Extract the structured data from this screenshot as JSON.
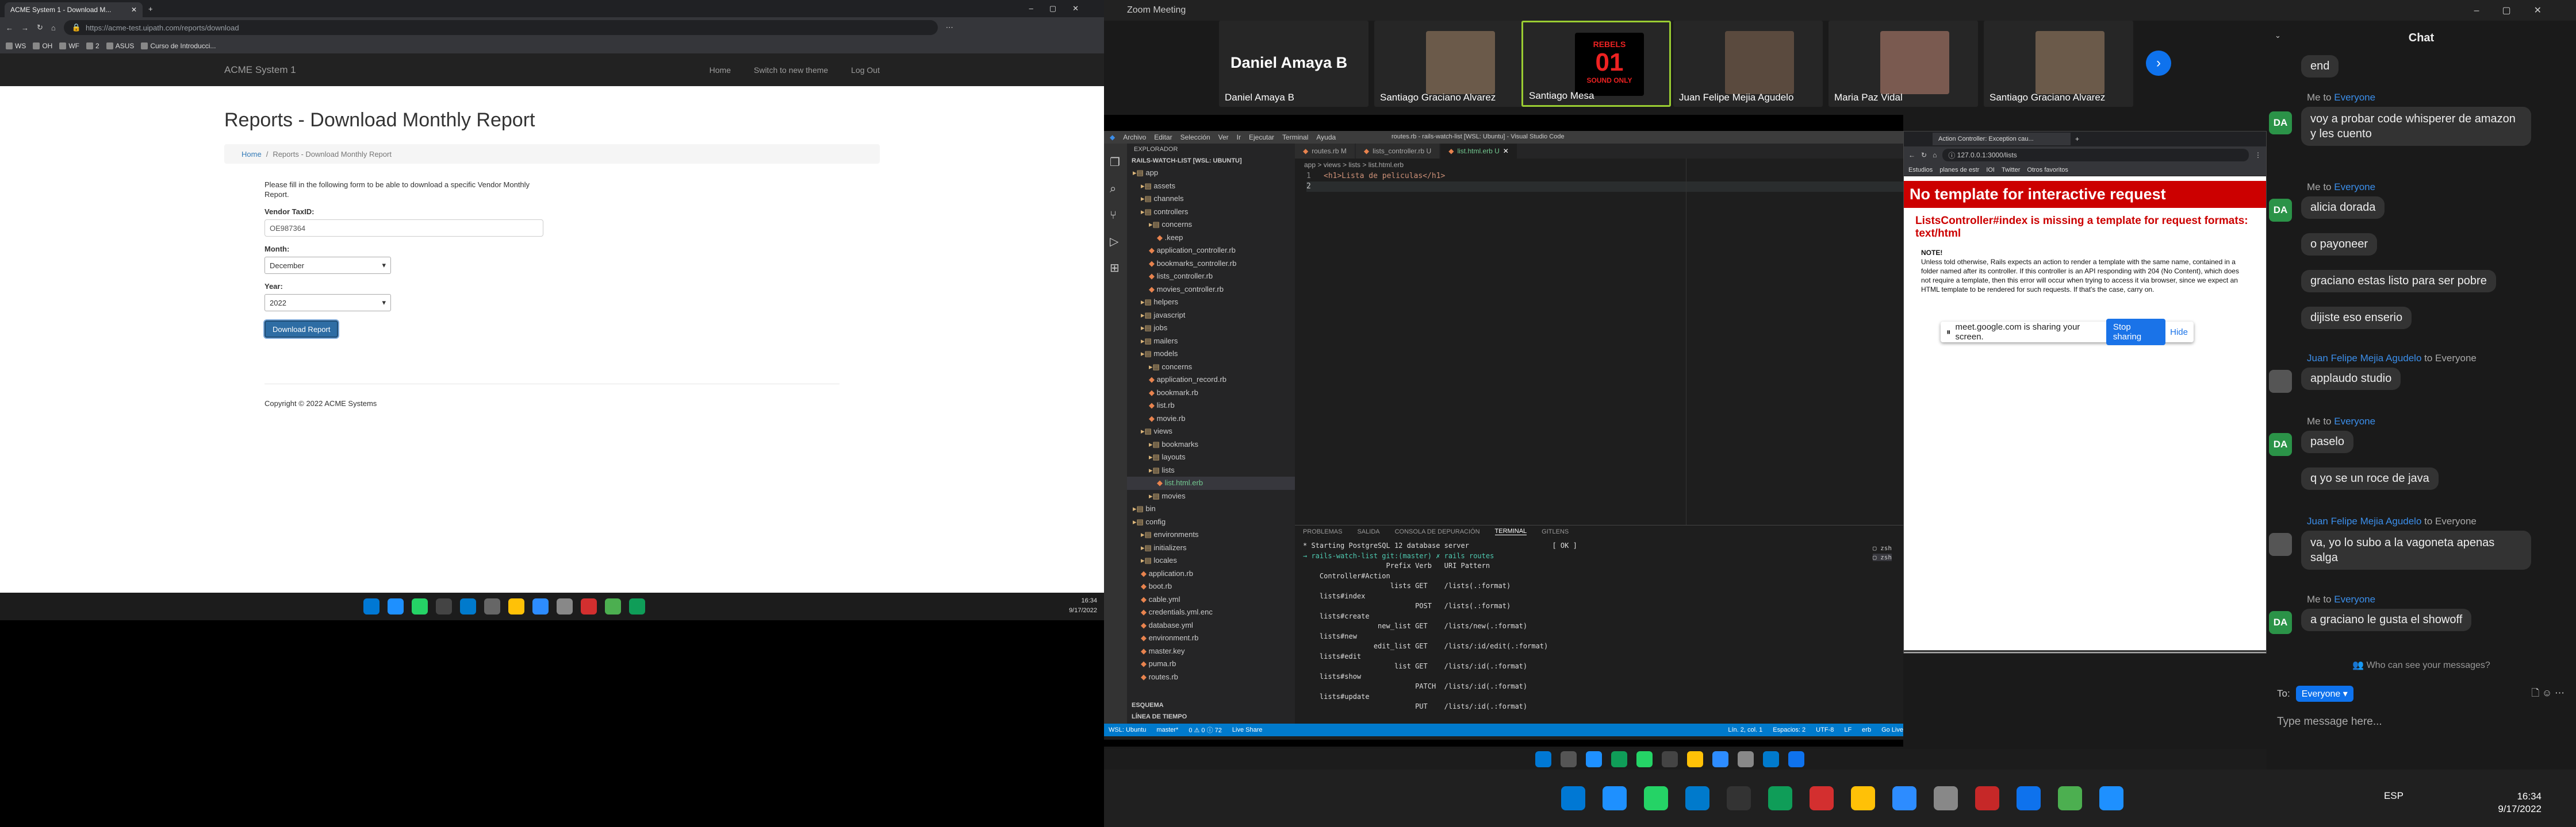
{
  "left_browser": {
    "tab_title": "ACME System 1 - Download M...",
    "url": "https://acme-test.uipath.com/reports/download",
    "bookmarks": [
      "WS",
      "OH",
      "WF",
      "2",
      "ASUS",
      "Curso de Introducci..."
    ],
    "navbar": {
      "brand": "ACME System 1",
      "links": [
        "Home",
        "Switch to new theme",
        "Log Out"
      ]
    },
    "page_title": "Reports - Download Monthly Report",
    "breadcrumb": {
      "home": "Home",
      "current": "Reports - Download Monthly Report"
    },
    "instructions": "Please fill in the following form to be able to download a specific Vendor Monthly Report.",
    "vendor_label": "Vendor TaxID:",
    "vendor_value": "OE987364",
    "month_label": "Month:",
    "month_value": "December",
    "year_label": "Year:",
    "year_value": "2022",
    "button": "Download Report",
    "footer": "Copyright © 2022 ACME Systems",
    "time": "16:34",
    "date": "9/17/2022"
  },
  "zoom": {
    "window_title": "Zoom Meeting",
    "participants": [
      "Daniel Amaya B",
      "Santiago Graciano Alvarez",
      "Santiago Mesa",
      "Juan Felipe Mejia Agudelo",
      "Maria Paz Vidal",
      "Santiago Graciano Alvarez"
    ],
    "featured_name": "Daniel Amaya B",
    "rebels_text": "REBELS",
    "rebels_sub": "SOUND ONLY",
    "share_text": "meet.google.com is sharing your screen.",
    "stop_label": "Stop sharing",
    "hide_label": "Hide",
    "chat": {
      "title": "Chat",
      "me": "Me to",
      "everyone": "Everyone",
      "msgs": [
        "end",
        "voy a probar code whisperer de amazon y les cuento",
        "alicia dorada",
        "o payoneer",
        "graciano estas listo para ser pobre",
        "dijiste eso enserio",
        "applaudo studio",
        "paselo",
        "q yo se un roce de java",
        "va, yo lo subo a la vagoneta apenas salga",
        "a graciano le gusta el showoff"
      ],
      "juan": "Juan Felipe Mejia Agudelo",
      "to_everyone": "to Everyone",
      "who_can_see": "Who can see your messages?",
      "to_label": "To:",
      "to_value": "Everyone",
      "placeholder": "Type message here...",
      "av": "DA"
    },
    "time": "16:34",
    "date": "9/17/2022",
    "lang": "ESP"
  },
  "vscode": {
    "title": "routes.rb - rails-watch-list [WSL: Ubuntu] - Visual Studio Code",
    "menus": [
      "Archivo",
      "Editar",
      "Selección",
      "Ver",
      "Ir",
      "Ejecutar",
      "Terminal",
      "Ayuda"
    ],
    "explorer": "EXPLORADOR",
    "project": "RAILS-WATCH-LIST [WSL: UBUNTU]",
    "tabs": [
      "routes.rb M",
      "lists_controller.rb U",
      "list.html.erb U"
    ],
    "tree": [
      "app",
      "assets",
      "channels",
      "controllers",
      "concerns",
      ".keep",
      "application_controller.rb",
      "bookmarks_controller.rb",
      "lists_controller.rb",
      "movies_controller.rb",
      "helpers",
      "javascript",
      "jobs",
      "mailers",
      "models",
      "concerns",
      "application_record.rb",
      "bookmark.rb",
      "list.rb",
      "movie.rb",
      "views",
      "bookmarks",
      "layouts",
      "lists",
      "list.html.erb",
      "movies",
      "bin",
      "config",
      "environments",
      "initializers",
      "locales",
      "application.rb",
      "boot.rb",
      "cable.yml",
      "credentials.yml.enc",
      "database.yml",
      "environment.rb",
      "master.key",
      "puma.rb",
      "routes.rb"
    ],
    "outline": "ESQUEMA",
    "timeline": "LÍNEA DE TIEMPO",
    "breadcrumb": "app > views > lists > list.html.erb",
    "code1": "<h1>Lista de peliculas</h1>",
    "panel_tabs": [
      "PROBLEMAS",
      "SALIDA",
      "CONSOLA DE DEPURACIÓN",
      "TERMINAL",
      "GITLENS"
    ],
    "term": [
      "* Starting PostgreSQL 12 database server                    [ OK ]",
      "→ rails-watch-list git:(master) ✗ rails routes",
      "                    Prefix Verb   URI Pattern",
      "    Controller#Action",
      "                     lists GET    /lists(.:format)",
      "    lists#index",
      "                           POST   /lists(.:format)",
      "    lists#create",
      "                  new_list GET    /lists/new(.:format)",
      "    lists#new",
      "                 edit_list GET    /lists/:id/edit(.:format)",
      "    lists#edit",
      "                      list GET    /lists/:id(.:format)",
      "    lists#show",
      "                           PATCH  /lists/:id(.:format)",
      "    lists#update",
      "                           PUT    /lists/:id(.:format)"
    ],
    "status": [
      "WSL: Ubuntu",
      "master*",
      "0 ⚠ 0 ⓘ 72",
      "Live Share",
      "Lín. 2, col. 1",
      "Espacios: 2",
      "UTF-8",
      "LF",
      "erb",
      "Go Live"
    ]
  },
  "small_browser": {
    "tab": "Action Controller: Exception cau...",
    "url": "127.0.0.1:3000/lists",
    "bookmarks": [
      "Estudios",
      "planes de estr",
      "IOI",
      "Twitter",
      "Otros favoritos"
    ],
    "error_title": "No template for interactive request",
    "error_sub": "ListsController#index is missing a template for request formats: text/html",
    "note_title": "NOTE!",
    "note": "Unless told otherwise, Rails expects an action to render a template with the same name, contained in a folder named after its controller. If this controller is an API responding with 204 (No Content), which does not require a template, then this error will occur when trying to access it via browser, since we expect an HTML template to be rendered for such requests. If that's the case, carry on."
  },
  "colors": {
    "zoom_blue": "#0e72ed",
    "error_red": "#cc0000",
    "chat_green": "#2b9348",
    "vscode_blue": "#007acc"
  }
}
